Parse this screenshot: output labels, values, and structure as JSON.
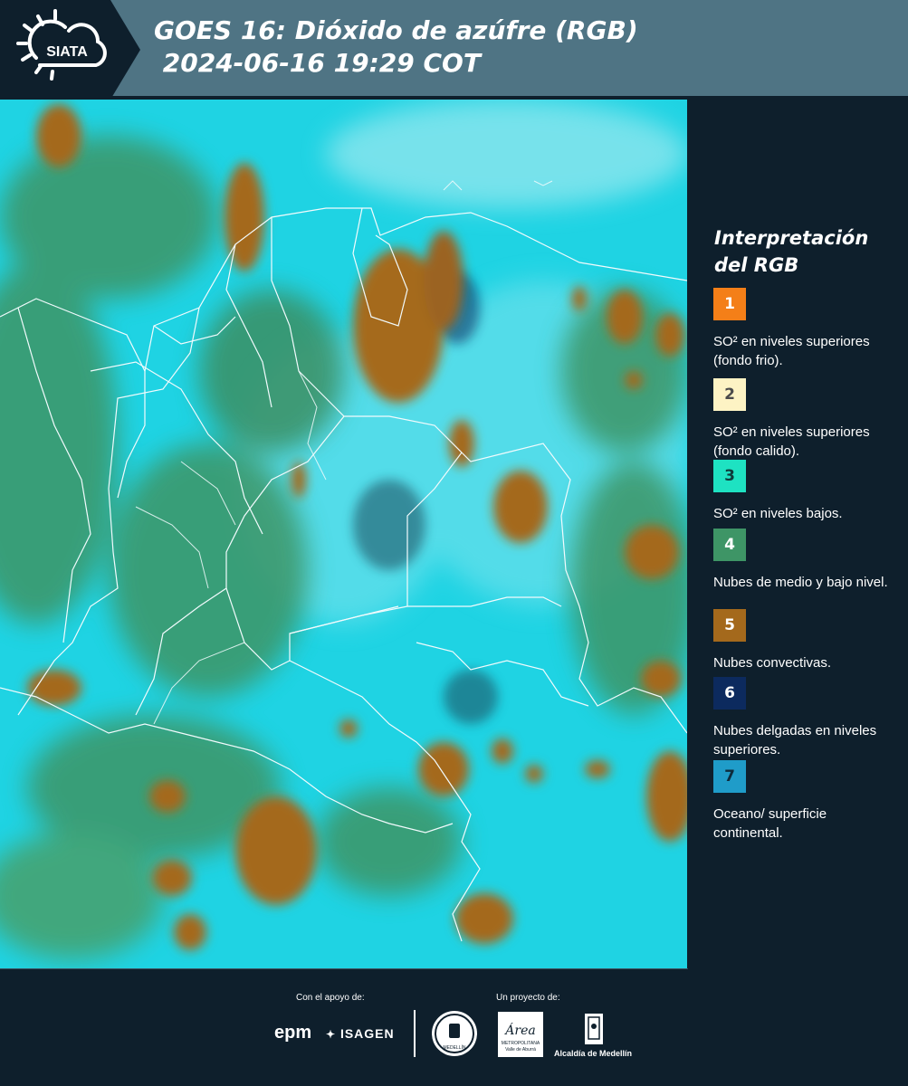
{
  "header": {
    "logo_text": "SIATA",
    "title_line1": "GOES 16: Dióxido de azúfre (RGB)",
    "title_line2": " 2024-06-16 19:29 COT"
  },
  "legend": {
    "title": "Interpretación del RGB",
    "items": [
      {
        "number": "1",
        "label": "SO² en niveles superiores (fondo frio).",
        "color": "#f47f18",
        "text_color": "#ffffff"
      },
      {
        "number": "2",
        "label": "SO² en niveles superiores (fondo calido).",
        "color": "#fdf3c4",
        "text_color": "#4b4b4b"
      },
      {
        "number": "3",
        "label": "SO² en niveles bajos.",
        "color": "#1ee2c2",
        "text_color": "#0e3b3b"
      },
      {
        "number": "4",
        "label": "Nubes de medio y bajo nivel.",
        "color": "#3e9566",
        "text_color": "#ffffff"
      },
      {
        "number": "5",
        "label": "Nubes convectivas.",
        "color": "#a4691c",
        "text_color": "#ffffff"
      },
      {
        "number": "6",
        "label": "Nubes delgadas en niveles superiores.",
        "color": "#0c2a5e",
        "text_color": "#ffffff"
      },
      {
        "number": "7",
        "label": "Oceano/ superficie continental.",
        "color": "#1f9cc9",
        "text_color": "#0e2b3b"
      }
    ]
  },
  "footer": {
    "support_label": "Con el apoyo de:",
    "project_label": "Un proyecto de:",
    "sponsor_epm": "epm",
    "sponsor_isagen": "ISAGEN",
    "area_name": "Área",
    "area_sub1": "METROPOLITANA",
    "area_sub2": "Valle de Aburrá",
    "alcaldia": "Alcaldía de Medellín",
    "seal_text": "MEDELLÍN"
  },
  "colors": {
    "header_bg": "#4f7484",
    "panel_bg": "#0e1f2c",
    "map_cyan": "#1ed6e6",
    "cloud_green": "#3e9566",
    "cloud_brown": "#a4691c"
  }
}
